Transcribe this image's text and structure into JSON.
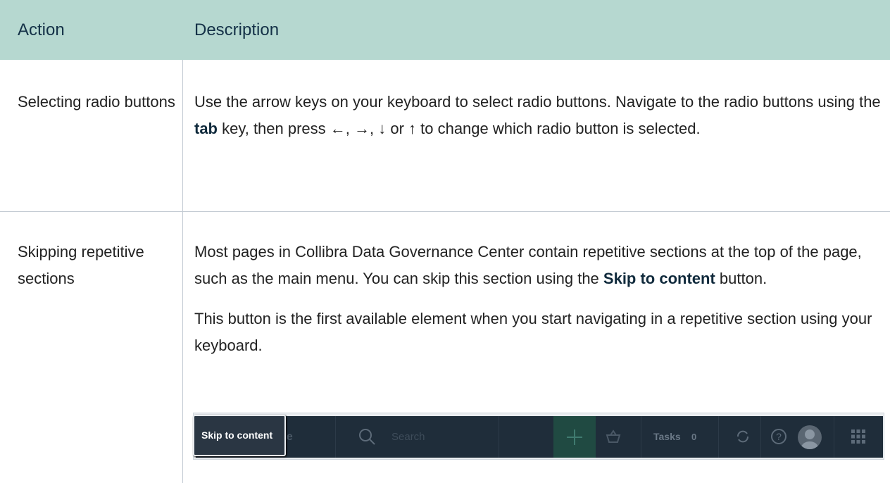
{
  "table": {
    "headers": {
      "action": "Action",
      "description": "Description"
    },
    "rows": [
      {
        "action": "Selecting radio buttons",
        "description": {
          "t1": "Use the arrow keys on your keyboard to select radio buttons. Navigate to the radio buttons using the ",
          "b1": "tab",
          "t2": " key, then press ←, →, ↓ or ↑ to change which radio button is selected."
        }
      },
      {
        "action": "Skipping repetitive sections",
        "description": {
          "p1_t1": "Most pages in Collibra Data Governance Center contain repetitive sections at the top of the page, such as the main menu. You can skip this section using the ",
          "p1_b1": "Skip to content",
          "p1_t2": " button.",
          "p2": "This button is the first available element when you start navigating in a repetitive section using your keyboard."
        }
      }
    ]
  },
  "screenshot": {
    "skip_button": "Skip to content",
    "browse_label": "Browse",
    "search_placeholder": "Search",
    "tasks_label": "Tasks",
    "tasks_count": "0",
    "icons": [
      "logo-icon",
      "browse-icon",
      "search-icon",
      "plus-icon",
      "basket-icon",
      "sync-icon",
      "help-icon",
      "avatar",
      "apps-grid-icon"
    ]
  },
  "colors": {
    "header_bg": "#b6d8d0",
    "header_text": "#143147",
    "topbar_bg": "#1f2d3a"
  }
}
